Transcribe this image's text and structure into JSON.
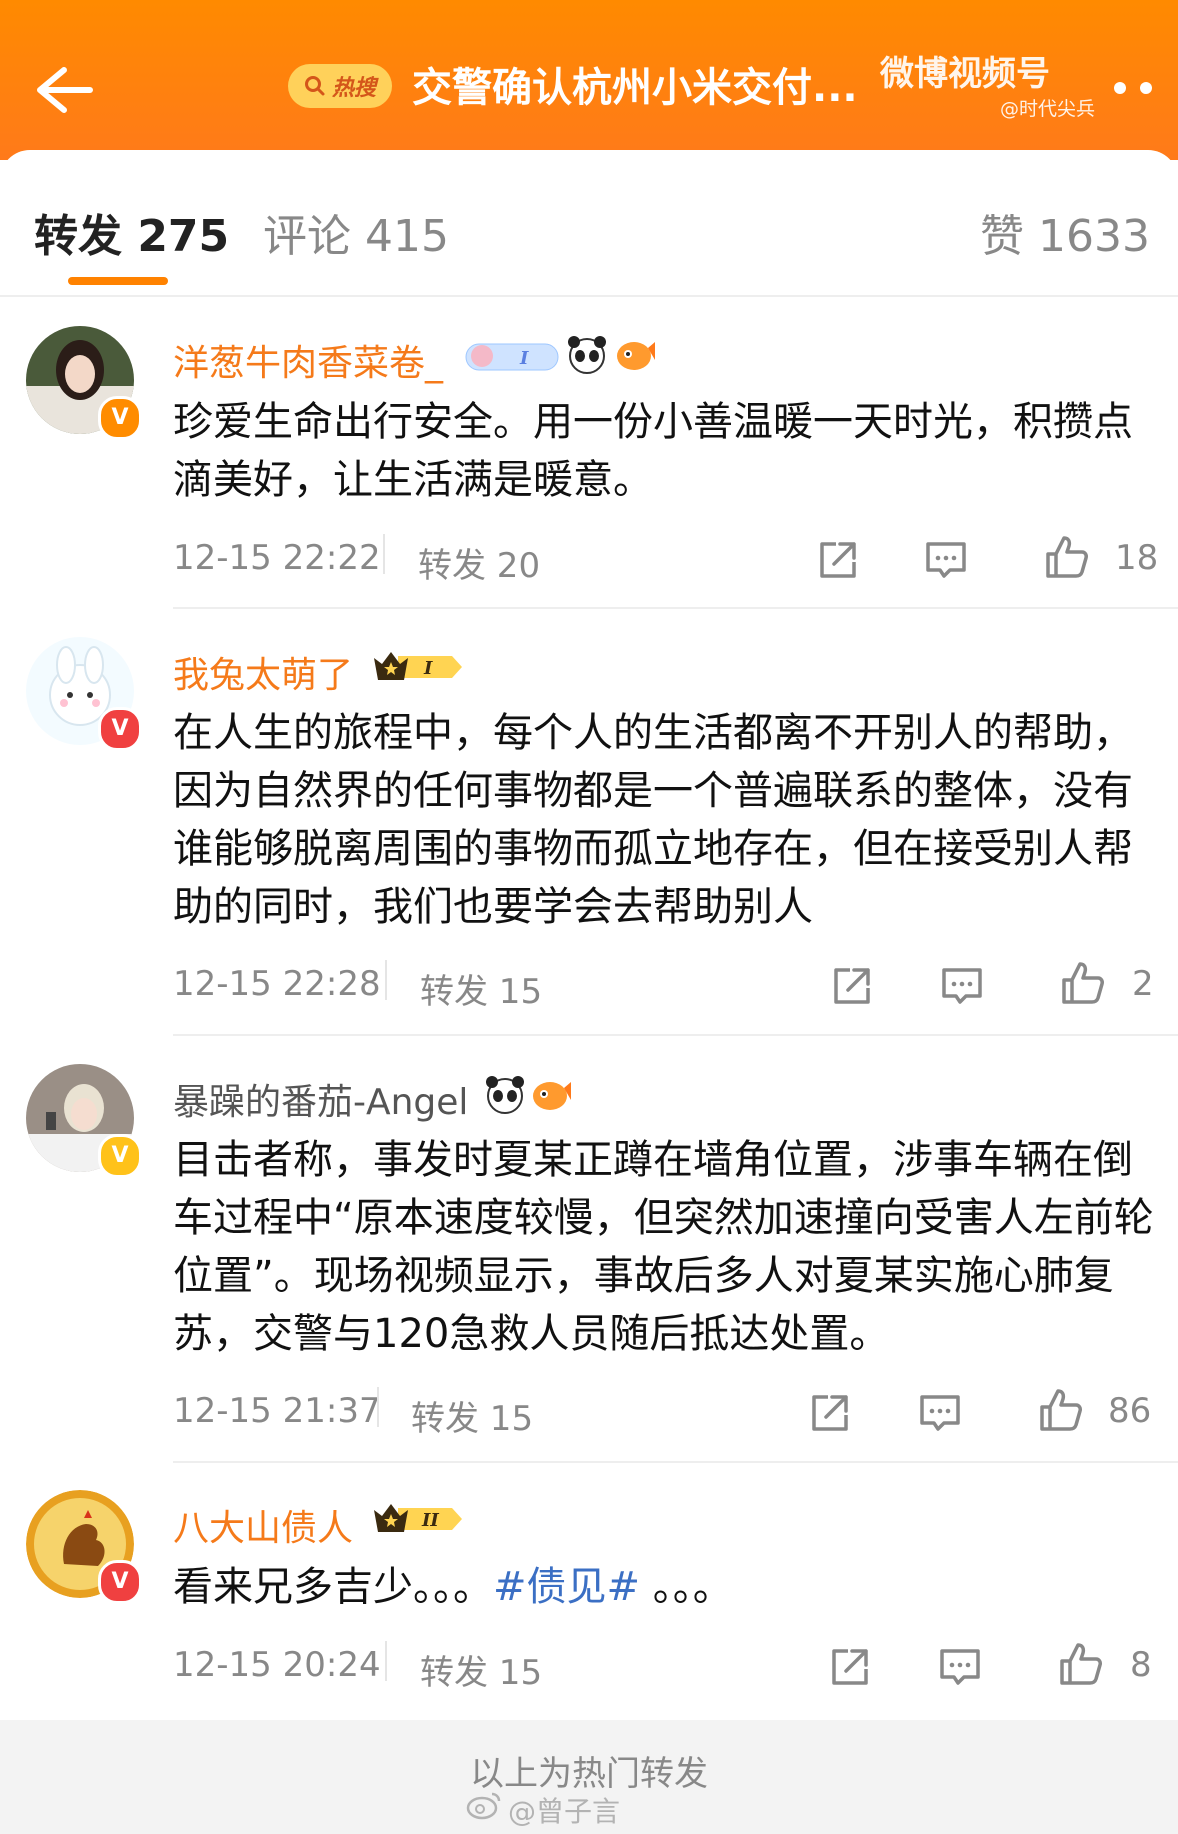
{
  "header": {
    "hot_label": "热搜",
    "title": "交警确认杭州小米交付...",
    "watermark_top": "微博视频号",
    "watermark_sub": "@时代尖兵"
  },
  "tabs": {
    "repost": "转发 275",
    "comments": "评论 415",
    "likes": "赞 1633"
  },
  "accent_color": "#ff8200",
  "comments": [
    {
      "username": "洋葱牛肉香菜卷_",
      "text": "珍爱生命出行安全。用一份小善温暖一天时光，积攒点滴美好，让生活满是暖意。",
      "time": "12-15 22:22",
      "repost": "转发 20",
      "likes": "18"
    },
    {
      "username": "我兔太萌了",
      "level": "I",
      "text": "在人生的旅程中，每个人的生活都离不开别人的帮助，因为自然界的任何事物都是一个普遍联系的整体，没有谁能够脱离周围的事物而孤立地存在，但在接受别人帮助的同时，我们也要学会去帮助别人",
      "time": "12-15 22:28",
      "repost": "转发 15",
      "likes": "2"
    },
    {
      "username": "暴躁的番茄-Angel",
      "text": "目击者称，事发时夏某正蹲在墙角位置，涉事车辆在倒车过程中“原本速度较慢，但突然加速撞向受害人左前轮位置”。现场视频显示，事故后多人对夏某实施心肺复苏，交警与120急救人员随后抵达处置。",
      "time": "12-15 21:37",
      "repost": "转发 15",
      "likes": "86"
    },
    {
      "username": "八大山债人",
      "level": "II",
      "text_before": "看来兄多吉少。。。",
      "hashtag": "#债见#",
      "text_after": "。。。",
      "time": "12-15 20:24",
      "repost": "转发 15",
      "likes": "8"
    }
  ],
  "footer": {
    "text": "以上为热门转发",
    "watermark": "@曾子言"
  }
}
